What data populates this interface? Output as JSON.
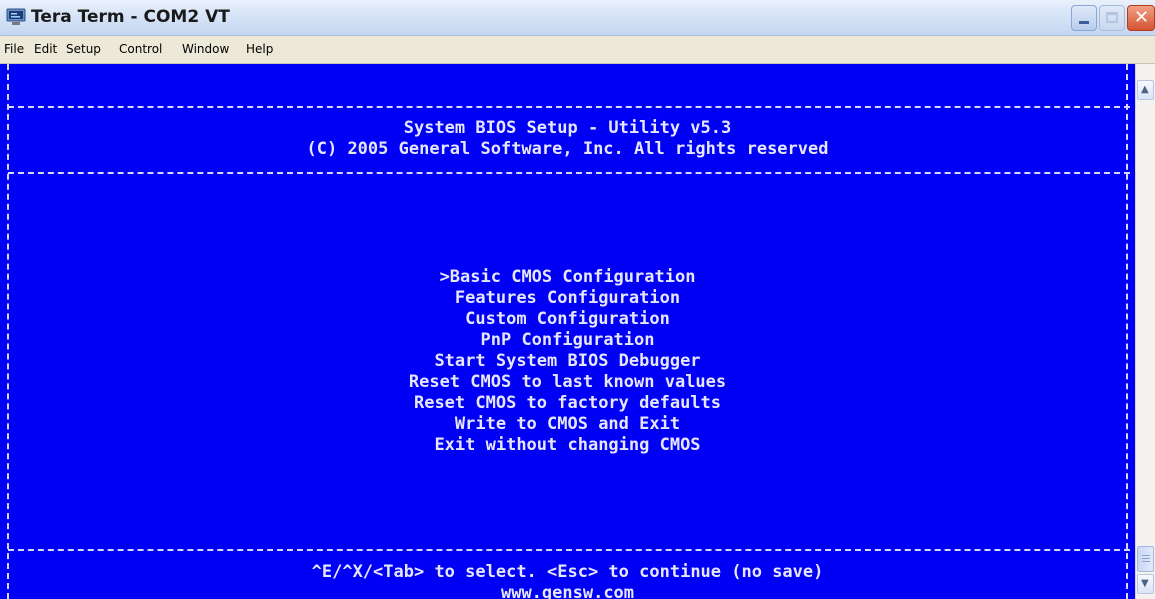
{
  "window": {
    "title": "Tera Term - COM2 VT",
    "close_glyph": "✕"
  },
  "menu": [
    "File",
    "Edit",
    "Setup",
    "Control",
    "Window",
    "Help"
  ],
  "terminal": {
    "header": [
      "System BIOS Setup - Utility v5.3",
      "(C) 2005 General Software, Inc. All rights reserved"
    ],
    "menu_items": [
      ">Basic CMOS Configuration",
      "Features Configuration",
      "Custom Configuration",
      "PnP Configuration",
      "Start System BIOS Debugger",
      "Reset CMOS to last known values",
      "Reset CMOS to factory defaults",
      "Write to CMOS and Exit",
      "Exit without changing CMOS"
    ],
    "footer": [
      "^E/^X/<Tab> to select. <Esc> to continue (no save)",
      "www.gensw.com"
    ]
  },
  "scrollbar": {
    "up_arrow": "▲",
    "down_arrow": "▼"
  },
  "colors": {
    "terminal_background": "#0000f5",
    "terminal_text": "#e6e6ff",
    "close_button": "#d45532"
  },
  "icons": {
    "app": "terminal-monitor-icon",
    "minimize": "minimize-icon",
    "maximize": "maximize-icon",
    "close": "close-icon"
  }
}
